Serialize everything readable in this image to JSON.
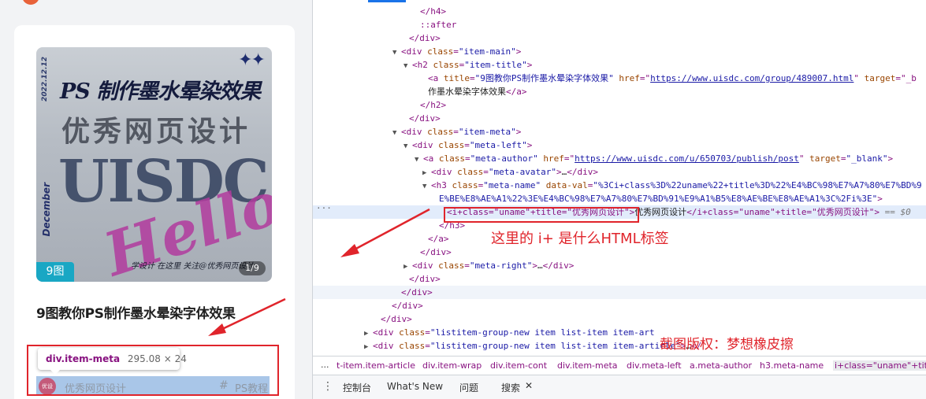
{
  "left": {
    "cover": {
      "date": "2022.12.12",
      "title": "PS 制作墨水晕染效果",
      "subtitle": "优秀网页设计",
      "big_text": "UISDC",
      "month": "December",
      "hello": "Hello",
      "slogan": "学设计 在这里  关注@优秀网页设计",
      "stars": "✦✦"
    },
    "image_count": "9图",
    "page_indicator": "1/9",
    "item_title": "9图教你PS制作墨水晕染字体效果",
    "tooltip": {
      "selector": "div.item-meta",
      "size": "295.08 × 24"
    },
    "meta": {
      "avatar_text": "优设",
      "author": "优秀网页设计",
      "hash": "#",
      "tag": "PS教程"
    }
  },
  "devtools": {
    "lines": [
      {
        "segs": [
          [
            "tg",
            "</h4>"
          ]
        ]
      },
      {
        "segs": [
          [
            "pe",
            "::after"
          ]
        ]
      },
      {
        "segs": [
          [
            "tg",
            "</div>"
          ]
        ]
      },
      {
        "tri": "▼",
        "segs": [
          [
            "tg",
            "<div "
          ],
          [
            "an",
            "class"
          ],
          [
            "tg",
            "="
          ],
          [
            "av",
            "\"item-main\""
          ],
          [
            "tg",
            ">"
          ]
        ]
      },
      {
        "tri": "▼",
        "segs": [
          [
            "tg",
            "<h2 "
          ],
          [
            "an",
            "class"
          ],
          [
            "tg",
            "="
          ],
          [
            "av",
            "\"item-title\""
          ],
          [
            "tg",
            ">"
          ]
        ]
      },
      {
        "segs": [
          [
            "tg",
            "<a "
          ],
          [
            "an",
            "title"
          ],
          [
            "tg",
            "="
          ],
          [
            "av",
            "\"9图教你PS制作墨水晕染字体效果\""
          ],
          [
            "tg",
            " "
          ],
          [
            "an",
            "href"
          ],
          [
            "tg",
            "=\""
          ],
          [
            "lk",
            "https://www.uisdc.com/group/489007.html"
          ],
          [
            "tg",
            "\" "
          ],
          [
            "an",
            "target"
          ],
          [
            "tg",
            "=\"_b"
          ]
        ]
      },
      {
        "segs": [
          [
            "tx",
            "作墨水晕染字体效果"
          ],
          [
            "tg",
            "</a>"
          ]
        ]
      },
      {
        "segs": [
          [
            "tg",
            "</h2>"
          ]
        ]
      },
      {
        "segs": [
          [
            "tg",
            "</div>"
          ]
        ]
      },
      {
        "tri": "▼",
        "segs": [
          [
            "tg",
            "<div "
          ],
          [
            "an",
            "class"
          ],
          [
            "tg",
            "="
          ],
          [
            "av",
            "\"item-meta\""
          ],
          [
            "tg",
            ">"
          ]
        ]
      },
      {
        "tri": "▼",
        "segs": [
          [
            "tg",
            "<div "
          ],
          [
            "an",
            "class"
          ],
          [
            "tg",
            "="
          ],
          [
            "av",
            "\"meta-left\""
          ],
          [
            "tg",
            ">"
          ]
        ]
      },
      {
        "tri": "▼",
        "segs": [
          [
            "tg",
            "<a "
          ],
          [
            "an",
            "class"
          ],
          [
            "tg",
            "="
          ],
          [
            "av",
            "\"meta-author\""
          ],
          [
            "tg",
            " "
          ],
          [
            "an",
            "href"
          ],
          [
            "tg",
            "=\""
          ],
          [
            "lk",
            "https://www.uisdc.com/u/650703/publish/post"
          ],
          [
            "tg",
            "\" "
          ],
          [
            "an",
            "target"
          ],
          [
            "tg",
            "="
          ],
          [
            "av",
            "\"_blank\""
          ],
          [
            "tg",
            ">"
          ]
        ]
      },
      {
        "tri": "▶",
        "segs": [
          [
            "tg",
            "<div "
          ],
          [
            "an",
            "class"
          ],
          [
            "tg",
            "="
          ],
          [
            "av",
            "\"meta-avatar\""
          ],
          [
            "tg",
            ">"
          ],
          [
            "tx",
            "…"
          ],
          [
            "tg",
            "</div>"
          ]
        ]
      },
      {
        "tri": "▼",
        "segs": [
          [
            "tg",
            "<h3 "
          ],
          [
            "an",
            "class"
          ],
          [
            "tg",
            "="
          ],
          [
            "av",
            "\"meta-name\""
          ],
          [
            "tg",
            " "
          ],
          [
            "an",
            "data-val"
          ],
          [
            "tg",
            "="
          ],
          [
            "av",
            "\"%3Ci+class%3D%22uname%22+title%3D%22%E4%BC%98%E7%A7%80%E7%BD%9"
          ]
        ]
      },
      {
        "segs": [
          [
            "av",
            "E%BE%E8%AE%A1%22%3E%E4%BC%98%E7%A7%80%E7%BD%91%E9%A1%B5%E8%AE%BE%E8%AE%A1%3C%2Fi%3E\""
          ],
          [
            "tg",
            ">"
          ]
        ]
      },
      {
        "segs": [
          [
            "tg",
            "<i+class=\"uname\"+title=\"优秀网页设计\">"
          ],
          [
            "tx",
            "优秀网页设计"
          ],
          [
            "tg",
            "</i+class=\"uname\"+title=\"优秀网页设计\">"
          ],
          [
            "dollar",
            " == $0"
          ]
        ]
      },
      {
        "segs": [
          [
            "tg",
            "</h3>"
          ]
        ]
      },
      {
        "segs": [
          [
            "tg",
            "</a>"
          ]
        ]
      },
      {
        "segs": [
          [
            "tg",
            "</div>"
          ]
        ]
      },
      {
        "tri": "▶",
        "segs": [
          [
            "tg",
            "<div "
          ],
          [
            "an",
            "class"
          ],
          [
            "tg",
            "="
          ],
          [
            "av",
            "\"meta-right\""
          ],
          [
            "tg",
            ">"
          ],
          [
            "tx",
            "…"
          ],
          [
            "tg",
            "</div>"
          ]
        ]
      },
      {
        "segs": [
          [
            "tg",
            "</div>"
          ]
        ]
      },
      {
        "segs": [
          [
            "tg",
            "</div>"
          ]
        ]
      },
      {
        "segs": [
          [
            "tg",
            "</div>"
          ]
        ]
      },
      {
        "segs": [
          [
            "tg",
            "</div>"
          ]
        ]
      },
      {
        "tri": "▶",
        "segs": [
          [
            "tg",
            "<div "
          ],
          [
            "an",
            "class"
          ],
          [
            "tg",
            "="
          ],
          [
            "av",
            "\"listitem-group-new item list-item item-art"
          ]
        ]
      },
      {
        "tri": "▶",
        "segs": [
          [
            "tg",
            "<div "
          ],
          [
            "an",
            "class"
          ],
          [
            "tg",
            "="
          ],
          [
            "av",
            "\"listitem-group-new item list-item item-article\""
          ],
          [
            "tg",
            ">"
          ],
          [
            "tx",
            "…"
          ],
          [
            "tg",
            "</"
          ]
        ]
      }
    ],
    "selected_ellipsis": "···",
    "annotation_question": "这里的 i+ 是什么HTML标签",
    "annotation_copyright": "截图版权：梦想橡皮擦",
    "breadcrumb": {
      "dots": "...",
      "items": [
        "t-item.item-article",
        "div.item-wrap",
        "div.item-cont",
        "div.item-meta",
        "div.meta-left",
        "a.meta-author",
        "h3.meta-name",
        "i+class=\"uname\"+title="
      ]
    },
    "drawer": {
      "menu_icon": "⋮",
      "tabs": [
        "控制台",
        "What's New",
        "问题",
        "搜索"
      ],
      "close": "✕"
    }
  },
  "colors": {
    "accent_red": "#e0242b",
    "devtools_blue": "#1a73e8",
    "badge_teal": "#19a7c4"
  }
}
